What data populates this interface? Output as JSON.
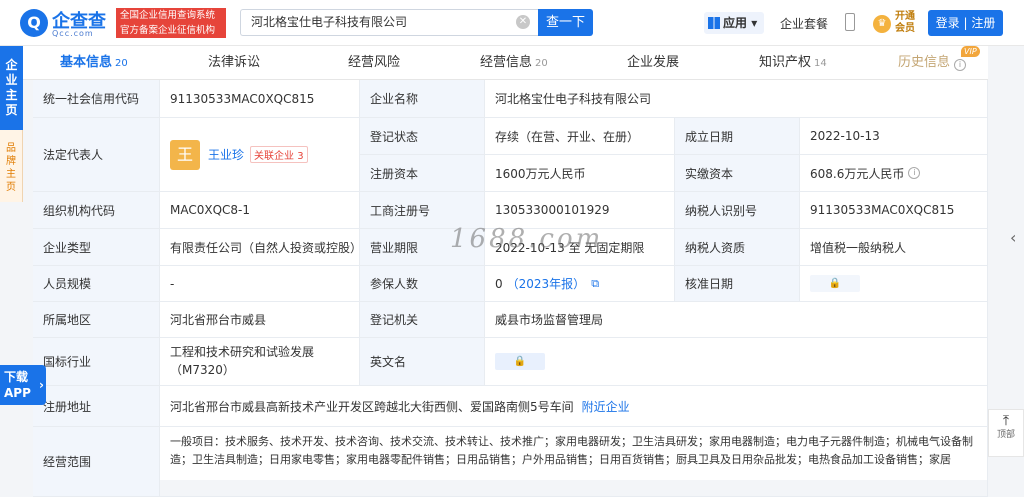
{
  "header": {
    "logo_glyph": "Q",
    "logo_name": "企查查",
    "logo_sub": "Qcc.com",
    "tagline_line1": "全国企业信用查询系统",
    "tagline_line2": "官方备案企业征信机构",
    "search_value": "河北格宝仕电子科技有限公司",
    "search_button": "查一下",
    "apps_label": "应用",
    "suite_label": "企业套餐",
    "vip_line1": "开通",
    "vip_line2": "会员",
    "login_label": "登录 | 注册"
  },
  "side": {
    "main_label": "企业主页",
    "brand_label": "品牌主页",
    "download_line1": "下载",
    "download_line2": "APP"
  },
  "tabs": [
    {
      "label": "基本信息",
      "count": "20"
    },
    {
      "label": "法律诉讼",
      "count": ""
    },
    {
      "label": "经营风险",
      "count": ""
    },
    {
      "label": "经营信息",
      "count": "20"
    },
    {
      "label": "企业发展",
      "count": ""
    },
    {
      "label": "知识产权",
      "count": "14"
    },
    {
      "label": "历史信息",
      "count": ""
    }
  ],
  "vip_badge": "VIP",
  "fields": {
    "credit_code_label": "统一社会信用代码",
    "credit_code": "91130533MAC0XQC815",
    "company_name_label": "企业名称",
    "company_name": "河北格宝仕电子科技有限公司",
    "legal_rep_label": "法定代表人",
    "legal_rep_avatar": "王",
    "legal_rep_name": "王业珍",
    "related_label": "关联企业",
    "related_count": "3",
    "reg_status_label": "登记状态",
    "reg_status": "存续（在营、开业、在册）",
    "est_date_label": "成立日期",
    "est_date": "2022-10-13",
    "reg_capital_label": "注册资本",
    "reg_capital": "1600万元人民币",
    "paid_capital_label": "实缴资本",
    "paid_capital": "608.6万元人民币",
    "org_code_label": "组织机构代码",
    "org_code": "MAC0XQC8-1",
    "biz_reg_no_label": "工商注册号",
    "biz_reg_no": "130533000101929",
    "taxpayer_id_label": "纳税人识别号",
    "taxpayer_id": "91130533MAC0XQC815",
    "company_type_label": "企业类型",
    "company_type": "有限责任公司（自然人投资或控股）",
    "biz_term_label": "营业期限",
    "biz_term": "2022-10-13 至 无固定期限",
    "taxpayer_qual_label": "纳税人资质",
    "taxpayer_qual": "增值税一般纳税人",
    "staff_size_label": "人员规模",
    "staff_size": "-",
    "insured_label": "参保人数",
    "insured_value": "0",
    "insured_year": "（2023年报）",
    "approval_date_label": "核准日期",
    "region_label": "所属地区",
    "region": "河北省邢台市威县",
    "reg_authority_label": "登记机关",
    "reg_authority": "威县市场监督管理局",
    "industry_label": "国标行业",
    "industry": "工程和技术研究和试验发展（M7320）",
    "eng_name_label": "英文名",
    "address_label": "注册地址",
    "address": "河北省邢台市威县高新技术产业开发区跨越北大街西侧、爱国路南侧5号车间",
    "nearby_label": "附近企业",
    "scope_label": "经营范围",
    "scope": "一般项目：技术服务、技术开发、技术咨询、技术交流、技术转让、技术推广；家用电器研发；卫生洁具研发；家用电器制造；电力电子元器件制造；机械电气设备制造；卫生洁具制造；日用家电零售；家用电器零配件销售；日用品销售；户外用品销售；日用百货销售；厨具卫具及日用杂品批发；电热食品加工设备销售；家居"
  },
  "watermark": "1688.com",
  "back_top_label": "顶部"
}
